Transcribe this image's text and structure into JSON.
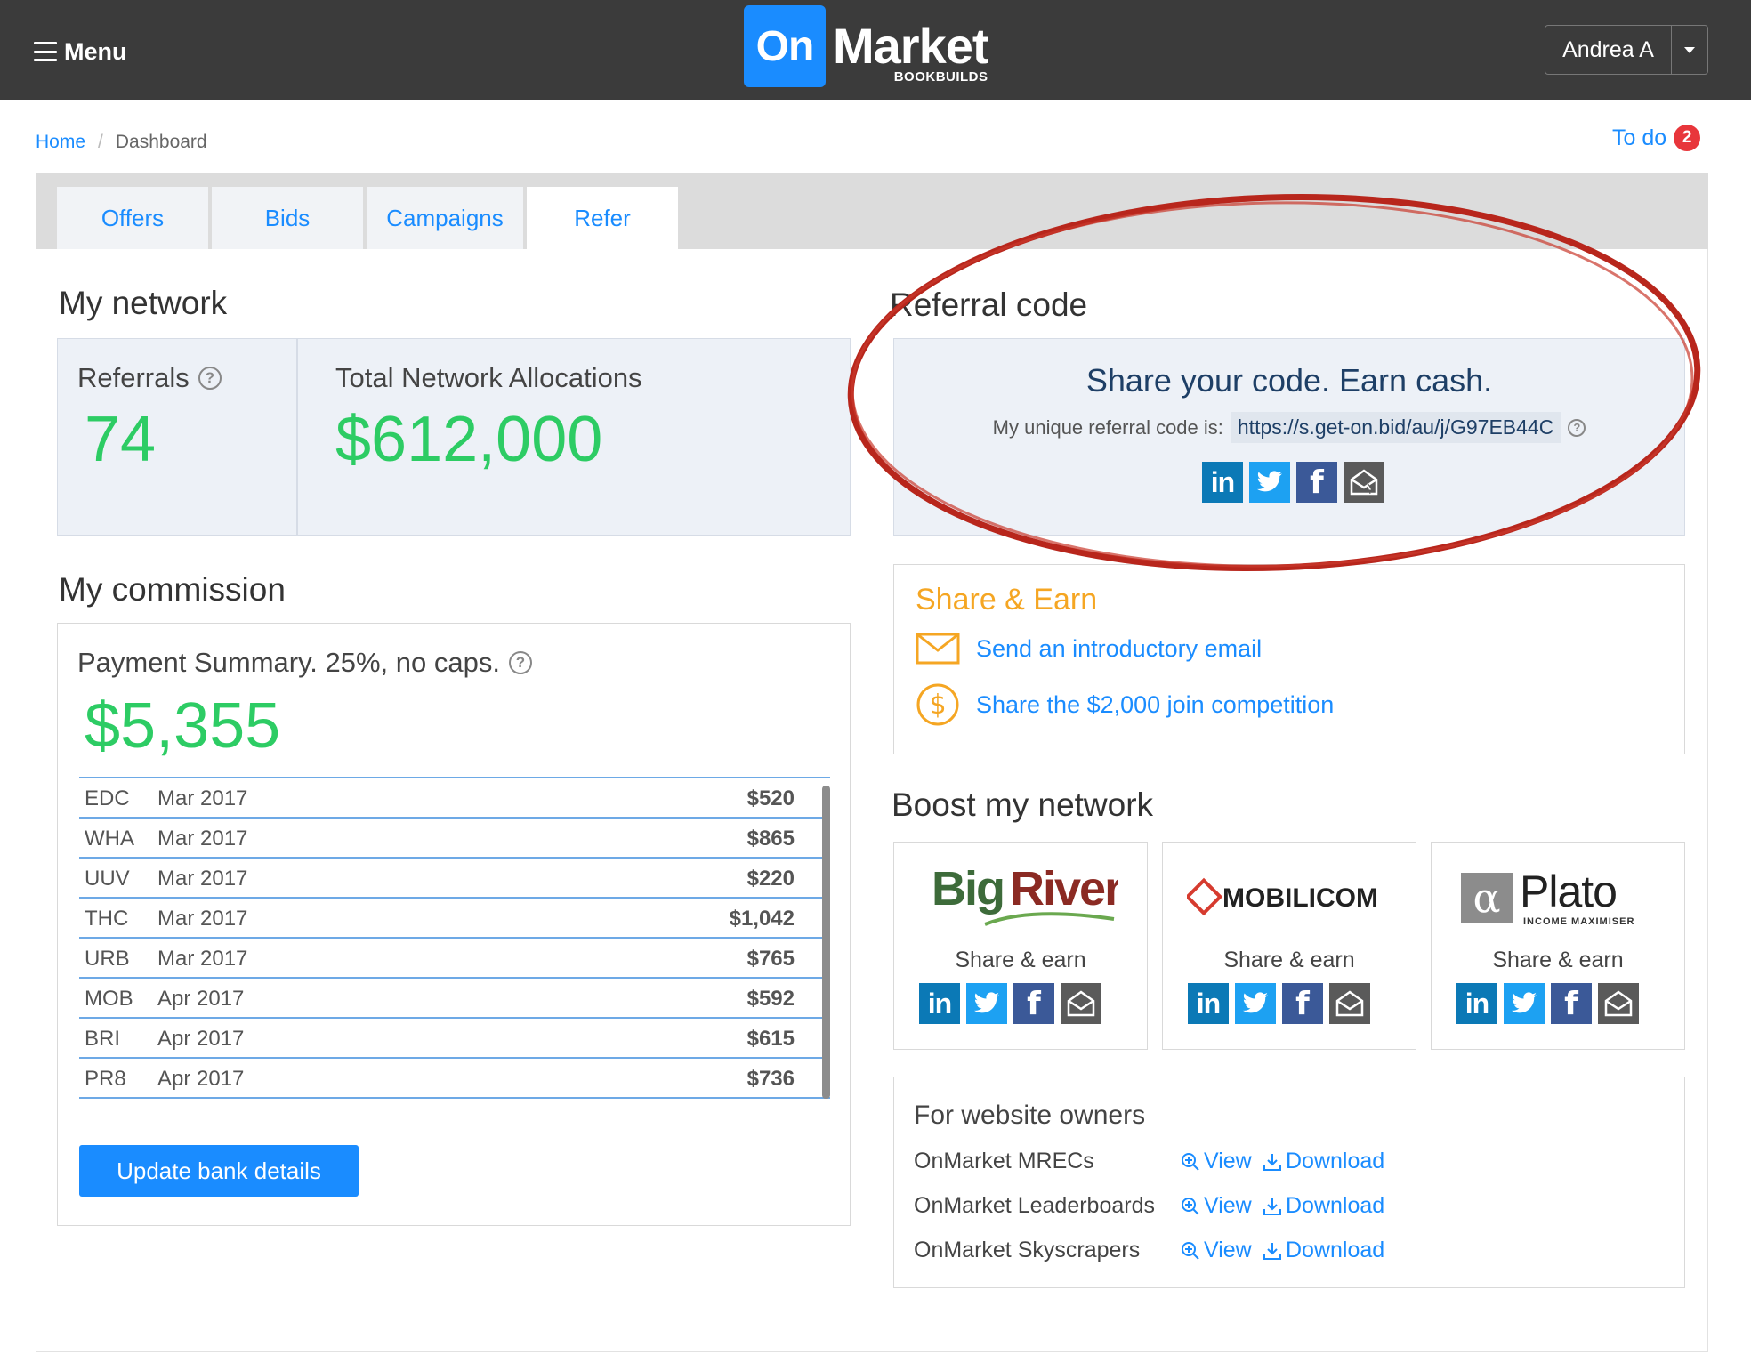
{
  "header": {
    "menu_label": "Menu",
    "logo_on": "On",
    "logo_market": "Market",
    "logo_sub": "BOOKBUILDS",
    "user_name": "Andrea A"
  },
  "breadcrumb": {
    "home": "Home",
    "separator": "/",
    "current": "Dashboard"
  },
  "todo": {
    "label": "To do",
    "count": "2"
  },
  "tabs": [
    {
      "label": "Offers"
    },
    {
      "label": "Bids"
    },
    {
      "label": "Campaigns"
    },
    {
      "label": "Refer",
      "active": true
    }
  ],
  "network": {
    "title": "My network",
    "referrals_label": "Referrals",
    "referrals_value": "74",
    "allocations_label": "Total Network Allocations",
    "allocations_value": "$612,000"
  },
  "commission": {
    "title": "My commission",
    "summary_label": "Payment Summary. 25%, no caps.",
    "summary_value": "$5,355",
    "rows": [
      {
        "code": "EDC",
        "date": "Mar 2017",
        "amount": "$520"
      },
      {
        "code": "WHA",
        "date": "Mar 2017",
        "amount": "$865"
      },
      {
        "code": "UUV",
        "date": "Mar 2017",
        "amount": "$220"
      },
      {
        "code": "THC",
        "date": "Mar 2017",
        "amount": "$1,042"
      },
      {
        "code": "URB",
        "date": "Mar 2017",
        "amount": "$765"
      },
      {
        "code": "MOB",
        "date": "Apr 2017",
        "amount": "$592"
      },
      {
        "code": "BRI",
        "date": "Apr 2017",
        "amount": "$615"
      },
      {
        "code": "PR8",
        "date": "Apr 2017",
        "amount": "$736"
      }
    ],
    "update_button": "Update bank details"
  },
  "referral": {
    "title": "Referral code",
    "headline": "Share your code. Earn cash.",
    "code_label": "My unique referral code is:",
    "code_url": "https://s.get-on.bid/au/j/G97EB44C"
  },
  "share_earn": {
    "title": "Share & Earn",
    "email_link": "Send an introductory email",
    "competition_link": "Share the $2,000 join competition"
  },
  "boost": {
    "title": "Boost my network",
    "cards": [
      {
        "brand": "BigRiver",
        "share_label": "Share & earn"
      },
      {
        "brand": "MOBILICOM",
        "share_label": "Share & earn"
      },
      {
        "brand": "Plato",
        "brand_sub": "INCOME MAXIMISER",
        "share_label": "Share & earn"
      }
    ]
  },
  "website_owners": {
    "title": "For website owners",
    "rows": [
      {
        "name": "OnMarket MRECs",
        "view": "View",
        "download": "Download"
      },
      {
        "name": "OnMarket Leaderboards",
        "view": "View",
        "download": "Download"
      },
      {
        "name": "OnMarket Skyscrapers",
        "view": "View",
        "download": "Download"
      }
    ]
  },
  "social": {
    "linkedin": "in",
    "facebook": "f"
  },
  "colors": {
    "accent_blue": "#1a8cff",
    "value_green": "#2dcc64",
    "share_orange": "#f5a623",
    "annotation_red": "#b8261c",
    "header_bg": "#3b3b3b"
  }
}
